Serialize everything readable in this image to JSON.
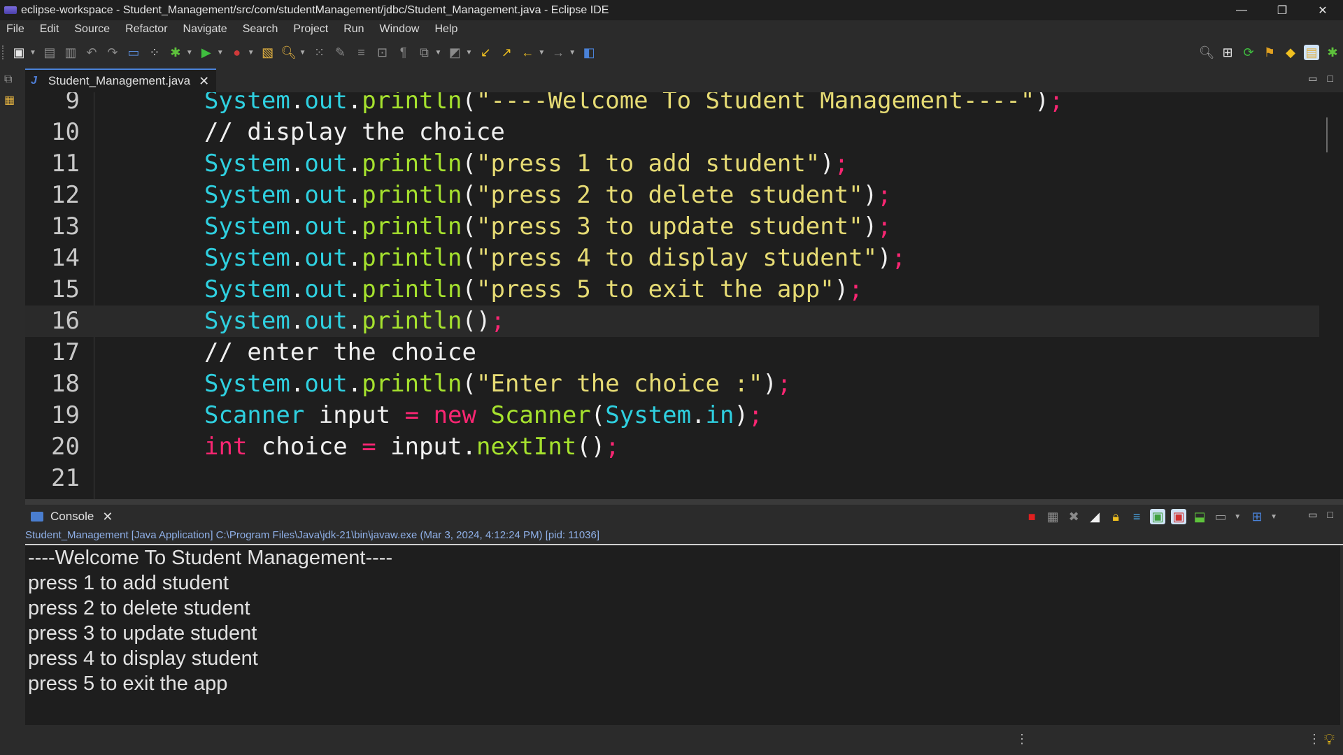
{
  "window": {
    "title": "eclipse-workspace - Student_Management/src/com/studentManagement/jdbc/Student_Management.java - Eclipse IDE",
    "minimize": "—",
    "restore": "❐",
    "close": "✕"
  },
  "menu": [
    "File",
    "Edit",
    "Source",
    "Refactor",
    "Navigate",
    "Search",
    "Project",
    "Run",
    "Window",
    "Help"
  ],
  "editor": {
    "tab_label": "Student_Management.java",
    "tab_icon": "J",
    "tab_close": "✕",
    "current_line": 16,
    "lines": [
      {
        "n": "9",
        "tokens": [
          [
            "cls",
            "System"
          ],
          [
            "dot",
            "."
          ],
          [
            "fld",
            "out"
          ],
          [
            "dot",
            "."
          ],
          [
            "mth",
            "println"
          ],
          [
            "pun",
            "("
          ],
          [
            "str",
            "\"----Welcome To Student Management----\""
          ],
          [
            "pun",
            ")"
          ],
          [
            "semi",
            ";"
          ]
        ]
      },
      {
        "n": "10",
        "tokens": [
          [
            "cm",
            "// display the choice"
          ]
        ]
      },
      {
        "n": "11",
        "tokens": [
          [
            "cls",
            "System"
          ],
          [
            "dot",
            "."
          ],
          [
            "fld",
            "out"
          ],
          [
            "dot",
            "."
          ],
          [
            "mth",
            "println"
          ],
          [
            "pun",
            "("
          ],
          [
            "str",
            "\"press 1 to add student\""
          ],
          [
            "pun",
            ")"
          ],
          [
            "semi",
            ";"
          ]
        ]
      },
      {
        "n": "12",
        "tokens": [
          [
            "cls",
            "System"
          ],
          [
            "dot",
            "."
          ],
          [
            "fld",
            "out"
          ],
          [
            "dot",
            "."
          ],
          [
            "mth",
            "println"
          ],
          [
            "pun",
            "("
          ],
          [
            "str",
            "\"press 2 to delete student\""
          ],
          [
            "pun",
            ")"
          ],
          [
            "semi",
            ";"
          ]
        ]
      },
      {
        "n": "13",
        "tokens": [
          [
            "cls",
            "System"
          ],
          [
            "dot",
            "."
          ],
          [
            "fld",
            "out"
          ],
          [
            "dot",
            "."
          ],
          [
            "mth",
            "println"
          ],
          [
            "pun",
            "("
          ],
          [
            "str",
            "\"press 3 to update student\""
          ],
          [
            "pun",
            ")"
          ],
          [
            "semi",
            ";"
          ]
        ]
      },
      {
        "n": "14",
        "tokens": [
          [
            "cls",
            "System"
          ],
          [
            "dot",
            "."
          ],
          [
            "fld",
            "out"
          ],
          [
            "dot",
            "."
          ],
          [
            "mth",
            "println"
          ],
          [
            "pun",
            "("
          ],
          [
            "str",
            "\"press 4 to display student\""
          ],
          [
            "pun",
            ")"
          ],
          [
            "semi",
            ";"
          ]
        ]
      },
      {
        "n": "15",
        "tokens": [
          [
            "cls",
            "System"
          ],
          [
            "dot",
            "."
          ],
          [
            "fld",
            "out"
          ],
          [
            "dot",
            "."
          ],
          [
            "mth",
            "println"
          ],
          [
            "pun",
            "("
          ],
          [
            "str",
            "\"press 5 to exit the app\""
          ],
          [
            "pun",
            ")"
          ],
          [
            "semi",
            ";"
          ]
        ]
      },
      {
        "n": "16",
        "tokens": [
          [
            "cls",
            "System"
          ],
          [
            "dot",
            "."
          ],
          [
            "fld",
            "out"
          ],
          [
            "dot",
            "."
          ],
          [
            "mth",
            "println"
          ],
          [
            "pun",
            "()"
          ],
          [
            "semi",
            ";"
          ]
        ]
      },
      {
        "n": "17",
        "tokens": [
          [
            "cm",
            "// enter the choice"
          ]
        ]
      },
      {
        "n": "18",
        "tokens": [
          [
            "cls",
            "System"
          ],
          [
            "dot",
            "."
          ],
          [
            "fld",
            "out"
          ],
          [
            "dot",
            "."
          ],
          [
            "mth",
            "println"
          ],
          [
            "pun",
            "("
          ],
          [
            "str",
            "\"Enter the choice :\""
          ],
          [
            "pun",
            ")"
          ],
          [
            "semi",
            ";"
          ]
        ]
      },
      {
        "n": "19",
        "tokens": [
          [
            "cls",
            "Scanner"
          ],
          [
            "var",
            " input "
          ],
          [
            "op",
            "="
          ],
          [
            "var",
            " "
          ],
          [
            "kw",
            "new"
          ],
          [
            "var",
            " "
          ],
          [
            "mth",
            "Scanner"
          ],
          [
            "pun",
            "("
          ],
          [
            "cls",
            "System"
          ],
          [
            "dot",
            "."
          ],
          [
            "fld",
            "in"
          ],
          [
            "pun",
            ")"
          ],
          [
            "semi",
            ";"
          ]
        ]
      },
      {
        "n": "20",
        "tokens": [
          [
            "kw",
            "int"
          ],
          [
            "var",
            " choice "
          ],
          [
            "op",
            "="
          ],
          [
            "var",
            " input"
          ],
          [
            "dot",
            "."
          ],
          [
            "mth",
            "nextInt"
          ],
          [
            "pun",
            "()"
          ],
          [
            "semi",
            ";"
          ]
        ]
      },
      {
        "n": "21",
        "tokens": []
      }
    ]
  },
  "console": {
    "tab_label": "Console",
    "tab_close": "✕",
    "description": "Student_Management [Java Application] C:\\Program Files\\Java\\jdk-21\\bin\\javaw.exe  (Mar 3, 2024, 4:12:24 PM) [pid: 11036]",
    "output": [
      "----Welcome To Student Management----",
      "press 1 to add student",
      "press 2 to delete student",
      "press 3 to update student",
      "press 4 to display student",
      "press 5 to exit the app"
    ]
  },
  "icons": {
    "toolbar_left": [
      "new-icon",
      "save-icon",
      "save-all-icon",
      "undo-icon",
      "redo-icon",
      "screen-icon",
      "dots-icon",
      "debug-icon",
      "run-icon",
      "run-last-icon",
      "open-type-icon",
      "search-icon",
      "hierarchy-icon",
      "pen-icon",
      "wrap-icon",
      "block-icon",
      "pilcrow-icon",
      "copy-icon",
      "annotate-icon",
      "prev-edit-icon",
      "next-annotation-icon",
      "back-icon",
      "forward-icon",
      "perspective-icon"
    ],
    "toolbar_right": [
      "search-icon",
      "open-perspective-icon",
      "git-icon",
      "ant-icon",
      "java-ee-icon",
      "java-perspective-icon",
      "debug-perspective-icon"
    ]
  },
  "colors": {
    "accent": "#4a82d8",
    "editor_bg": "#1e1e1e",
    "chrome_bg": "#2b2b2b",
    "string": "#e6db74",
    "class": "#2fd0e0",
    "method": "#a6e22e",
    "keyword": "#f92672"
  }
}
